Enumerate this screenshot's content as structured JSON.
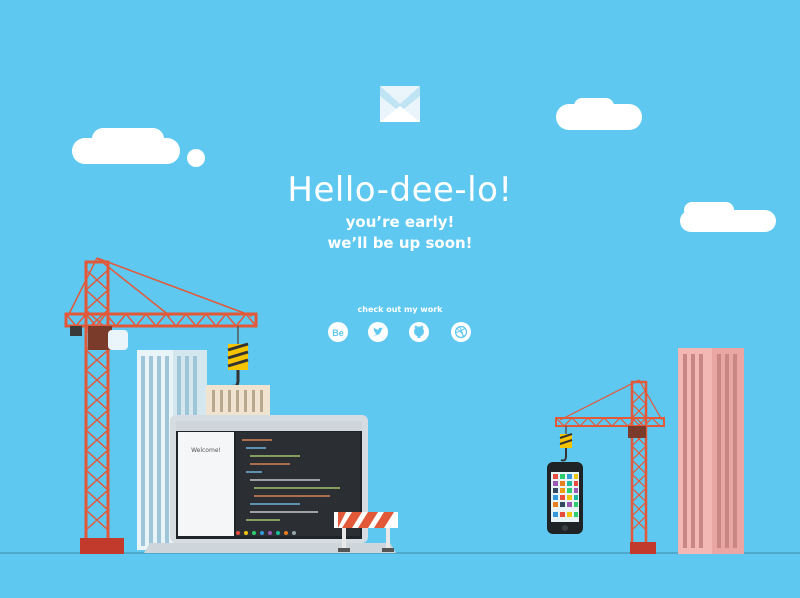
{
  "hero": {
    "headline": "Hello-dee-lo!",
    "tagline_line1": "you’re early!",
    "tagline_line2": "we’ll be up soon!"
  },
  "social": {
    "label": "check out my work",
    "links": [
      {
        "icon": "behance-icon",
        "text": "Be"
      },
      {
        "icon": "twitter-icon"
      },
      {
        "icon": "github-icon"
      },
      {
        "icon": "dribbble-icon"
      }
    ]
  },
  "laptop_screen": {
    "welcome_text": "Welcome!"
  },
  "colors": {
    "sky": "#5ec8f0",
    "crane": "#e2593a",
    "building_pink": "#f3b8b4",
    "white": "#ffffff"
  }
}
